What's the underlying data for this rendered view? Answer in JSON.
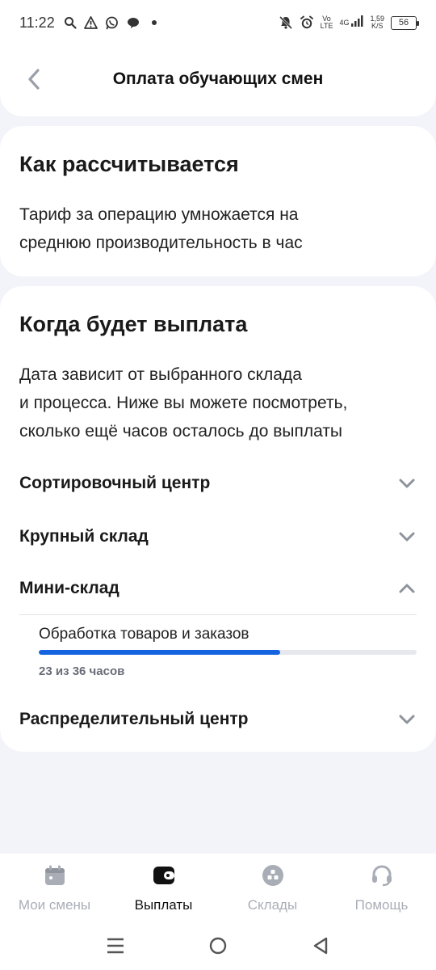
{
  "status_bar": {
    "time": "11:22",
    "network": "4G",
    "carrier_top": "Vo",
    "carrier_bottom": "LTE",
    "speed_top": "1,59",
    "speed_bottom": "K/S",
    "battery": "56",
    "left_icons": [
      "search-icon",
      "warning-icon",
      "whatsapp-icon",
      "message-icon",
      "dot-icon"
    ],
    "right_icons": [
      "mute-icon",
      "alarm-icon",
      "signal-icon"
    ]
  },
  "header": {
    "title": "Оплата обучающих смен",
    "back_icon": "chevron-left-icon"
  },
  "calc_card": {
    "title": "Как рассчитывается",
    "text_line1": "Тариф за операцию умножается на",
    "text_line2": "среднюю производительность в час"
  },
  "payout_card": {
    "title": "Когда будет выплата",
    "text_line1": "Дата зависит от выбранного склада",
    "text_line2": "и процесса. Ниже вы можете посмотреть,",
    "text_line3": "сколько ещё часов осталось до выплаты",
    "items": [
      {
        "label": "Сортировочный центр",
        "expanded": false
      },
      {
        "label": "Крупный склад",
        "expanded": false
      },
      {
        "label": "Мини-склад",
        "expanded": true
      },
      {
        "label": "Распределительный центр",
        "expanded": false
      }
    ],
    "process": {
      "label": "Обработка товаров и заказов",
      "done_hours": 23,
      "total_hours": 36,
      "caption": "23 из 36 часов"
    }
  },
  "bottom_nav": {
    "items": [
      {
        "label": "Мои смены",
        "icon": "calendar-icon",
        "active": false
      },
      {
        "label": "Выплаты",
        "icon": "wallet-icon",
        "active": true
      },
      {
        "label": "Склады",
        "icon": "warehouse-icon",
        "active": false
      },
      {
        "label": "Помощь",
        "icon": "headset-icon",
        "active": false
      }
    ]
  },
  "colors": {
    "accent": "#1463e0",
    "background": "#f3f4f9",
    "inactive": "#a9adb6",
    "chevron": "#8e939c"
  }
}
